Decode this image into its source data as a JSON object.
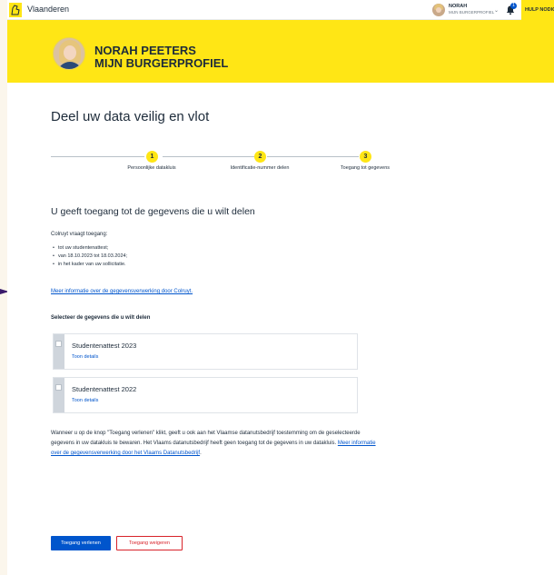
{
  "header": {
    "brand": "Vlaanderen",
    "user_name": "NORAH",
    "user_sub": "MIJN BURGERPROFIEL",
    "user_chevron": "⌄",
    "notification_count": "1",
    "help_label": "HULP NODIG?"
  },
  "hero": {
    "name": "NORAH PEETERS",
    "subtitle": "MIJN BURGERPROFIEL"
  },
  "main": {
    "title": "Deel uw data veilig en vlot",
    "steps": [
      {
        "number": "1",
        "label": "Persoonlijke datakluis"
      },
      {
        "number": "2",
        "label": "Identificatie-nummer delen"
      },
      {
        "number": "3",
        "label": "Toegang tot gegevens"
      }
    ],
    "section_title": "U geeft toegang tot de gegevens die u wilt delen",
    "intro": "Colruyt vraagt toegang:",
    "bullets": [
      "tot uw studentenattest;",
      "van 18.10.2023 tot 18.03.2024;",
      "in het kader van uw sollicitatie."
    ],
    "more_info_link": "Meer informatie over de gegevensverwerking door Colruyt.",
    "select_title": "Selecteer de gegevens die u wilt delen",
    "cards": [
      {
        "title": "Studentenattest 2023",
        "link": "Toon details"
      },
      {
        "title": "Studentenattest 2022",
        "link": "Toon details"
      }
    ],
    "consent_text": "Wanneer u op de knop \"Toegang verlenen\" klikt, geeft u ook aan het Vlaamse datanutsbedrijf toestemming om de geselecteerde gegevens in uw datakluis te bewaren. Het Vlaams datanutsbedrijf heeft geen toegang tot de gegevens in uw datakluis. ",
    "consent_link": "Meer informatie over de gegevensverwerking door het Vlaams Datanutsbedrijf",
    "consent_end": ".",
    "grant_button": "Toegang verlenen",
    "deny_button": "Toegang weigeren"
  },
  "colors": {
    "accent_yellow": "#ffe615",
    "link_blue": "#0055cc",
    "deny_red": "#d8232a"
  }
}
